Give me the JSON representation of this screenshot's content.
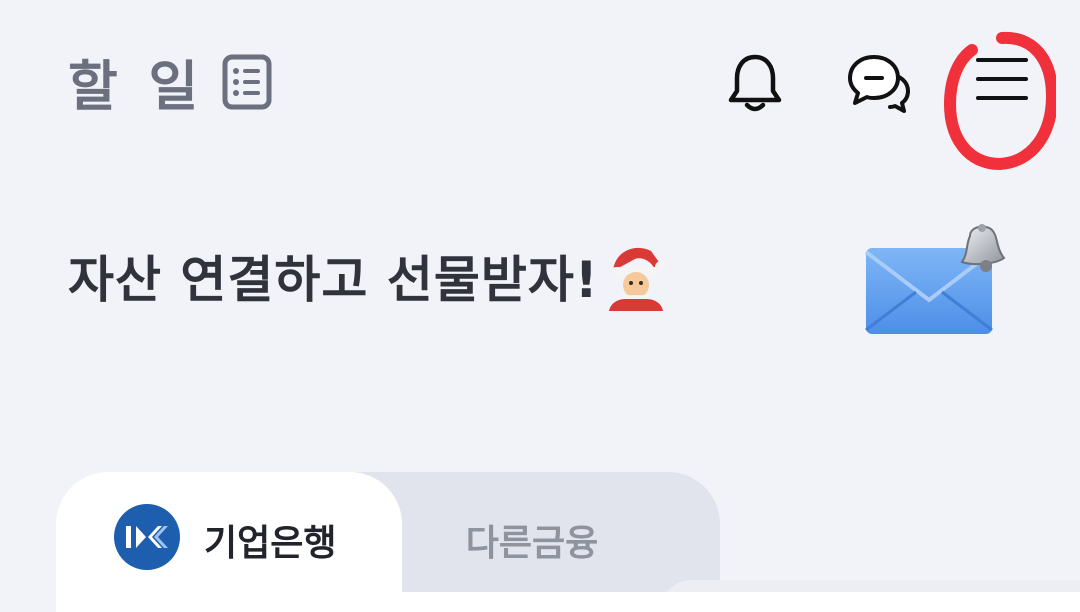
{
  "header": {
    "todo_label": "할 일",
    "icons": {
      "todo_list": "list-icon",
      "notifications": "bell-icon",
      "chat": "chat-icon",
      "menu": "hamburger-menu-icon"
    }
  },
  "promo": {
    "text": "자산 연결하고 선물받자!",
    "emoji_icon": "santa-icon",
    "illustration": "envelope-bell-icon"
  },
  "tabs": [
    {
      "label": "기업은행",
      "icon": "ibk-logo",
      "active": true
    },
    {
      "label": "다른금융",
      "active": false
    }
  ],
  "colors": {
    "background": "#f2f3f8",
    "highlight_circle": "#f0303a",
    "active_tab": "#ffffff",
    "inactive_tab": "#e1e4ed",
    "ibk_blue": "#1d5fae"
  }
}
